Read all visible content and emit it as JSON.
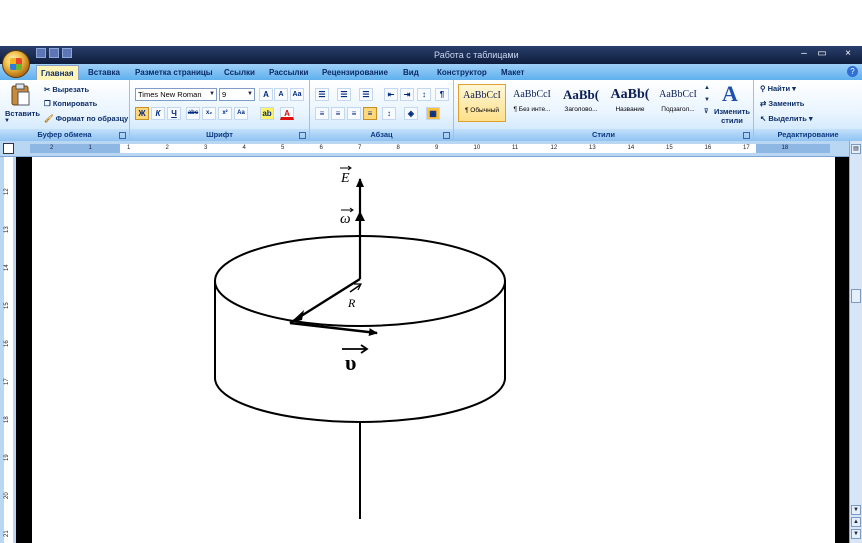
{
  "window": {
    "title": "",
    "contextual_tools": "Работа с таблицами",
    "controls": [
      "–",
      "▭",
      "×"
    ]
  },
  "tabs": [
    {
      "label": "Главная",
      "active": true
    },
    {
      "label": "Вставка"
    },
    {
      "label": "Разметка страницы"
    },
    {
      "label": "Ссылки"
    },
    {
      "label": "Рассылки"
    },
    {
      "label": "Рецензирование"
    },
    {
      "label": "Вид"
    },
    {
      "label": "Конструктор"
    },
    {
      "label": "Макет"
    }
  ],
  "clipboard": {
    "paste": "Вставить",
    "cut": "Вырезать",
    "copy": "Копировать",
    "format_painter": "Формат по образцу",
    "group_label": "Буфер обмена"
  },
  "font": {
    "name": "Times New Roman",
    "size": "9",
    "group_label": "Шрифт"
  },
  "paragraph": {
    "group_label": "Абзац"
  },
  "styles": {
    "items": [
      {
        "sample": "AaBbCcI",
        "name": "¶ Обычный",
        "selected": true
      },
      {
        "sample": "AaBbCcI",
        "name": "¶ Без инте..."
      },
      {
        "sample": "AaBb(",
        "name": "Заголово..."
      },
      {
        "sample": "AaBb(",
        "name": "Название"
      },
      {
        "sample": "AaBbCcI",
        "name": "Подзагол..."
      }
    ],
    "change_styles": "Изменить стили",
    "group_label": "Стили"
  },
  "editing": {
    "find": "Найти",
    "replace": "Заменить",
    "select": "Выделить",
    "group_label": "Редактирование"
  },
  "ruler_numbers": [
    "2",
    "1",
    "1",
    "2",
    "3",
    "4",
    "5",
    "6",
    "7",
    "8",
    "9",
    "10",
    "11",
    "12",
    "13",
    "14",
    "15",
    "16",
    "17",
    "18"
  ],
  "vruler_numbers": [
    "12",
    "13",
    "14",
    "15",
    "16",
    "17",
    "18",
    "19",
    "20",
    "21"
  ],
  "figure": {
    "label_E": "E",
    "label_omega": "ω",
    "label_R": "R",
    "label_v": "υ"
  }
}
